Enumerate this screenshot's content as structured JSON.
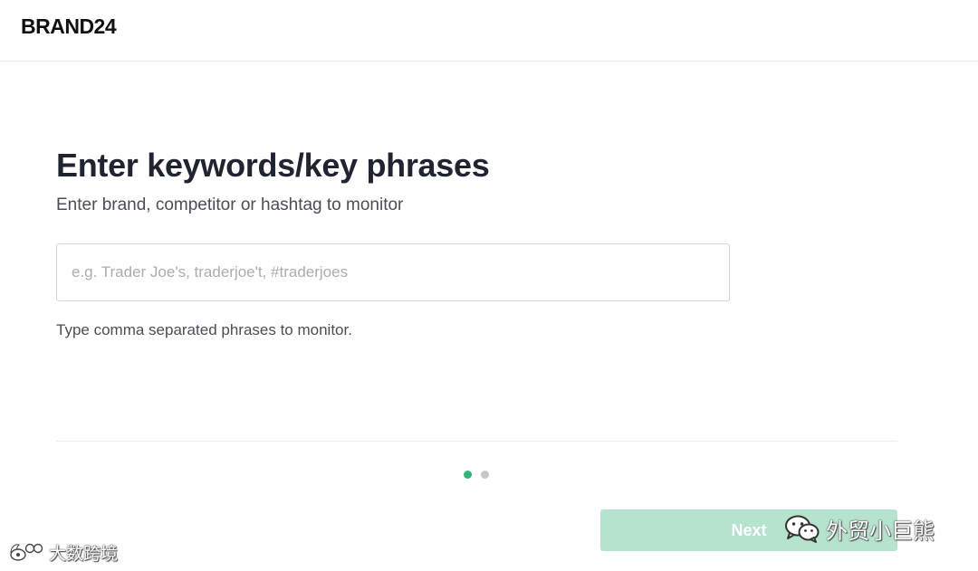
{
  "header": {
    "logo_text": "BRAND24"
  },
  "main": {
    "title": "Enter keywords/key phrases",
    "subtitle": "Enter brand, competitor or hashtag to monitor",
    "keyword_input": {
      "value": "",
      "placeholder": "e.g. Trader Joe's, traderjoe't, #traderjoes"
    },
    "hint": "Type comma separated phrases to monitor."
  },
  "stepper": {
    "current_step": 1,
    "total_steps": 2,
    "active_color": "#2eb67d",
    "inactive_color": "#c4c8cc"
  },
  "footer": {
    "next_label": "Next",
    "next_color": "#b6e3cd"
  },
  "watermarks": {
    "left_icon": "weibo-icon",
    "left_text": "大数跨境",
    "right_icon": "wechat-icon",
    "right_text": "外贸小巨熊"
  }
}
